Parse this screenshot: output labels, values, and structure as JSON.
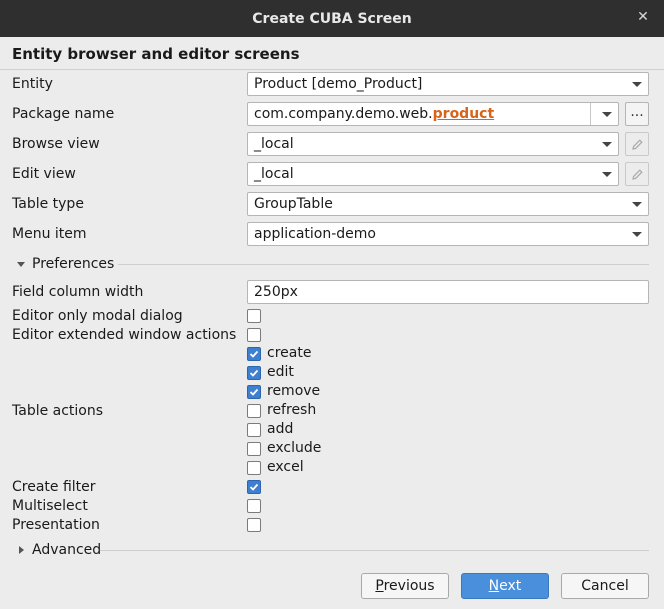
{
  "window": {
    "title": "Create CUBA Screen"
  },
  "heading": "Entity browser and editor screens",
  "fields": {
    "entity": {
      "label": "Entity",
      "value": "Product [demo_Product]"
    },
    "package": {
      "label": "Package name",
      "value_prefix": "com.company.demo.web.",
      "value_highlight": "product",
      "browse_label": "..."
    },
    "browse_view": {
      "label": "Browse view",
      "value": "_local"
    },
    "edit_view": {
      "label": "Edit view",
      "value": "_local"
    },
    "table_type": {
      "label": "Table type",
      "value": "GroupTable"
    },
    "menu_item": {
      "label": "Menu item",
      "value": "application-demo"
    }
  },
  "preferences": {
    "title": "Preferences",
    "field_column_width": {
      "label": "Field column width",
      "value": "250px"
    },
    "editor_only_modal": {
      "label": "Editor only modal dialog",
      "checked": false
    },
    "editor_extended_actions": {
      "label": "Editor extended window actions",
      "checked": false
    },
    "table_actions": {
      "label": "Table actions",
      "items": [
        {
          "label": "create",
          "checked": true
        },
        {
          "label": "edit",
          "checked": true
        },
        {
          "label": "remove",
          "checked": true
        },
        {
          "label": "refresh",
          "checked": false
        },
        {
          "label": "add",
          "checked": false
        },
        {
          "label": "exclude",
          "checked": false
        },
        {
          "label": "excel",
          "checked": false
        }
      ]
    },
    "create_filter": {
      "label": "Create filter",
      "checked": true
    },
    "multiselect": {
      "label": "Multiselect",
      "checked": false
    },
    "presentation": {
      "label": "Presentation",
      "checked": false
    }
  },
  "advanced": {
    "title": "Advanced"
  },
  "buttons": {
    "previous_mnemonic": "P",
    "previous_rest": "revious",
    "next_mnemonic": "N",
    "next_rest": "ext",
    "cancel": "Cancel"
  },
  "colors": {
    "accent": "#4a8fdc",
    "highlight": "#d9631a",
    "titlebar": "#2f2f2f"
  }
}
